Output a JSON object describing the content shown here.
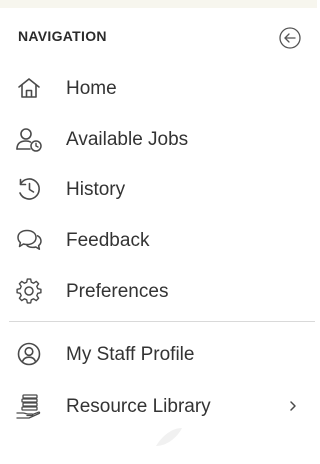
{
  "header": {
    "title": "NAVIGATION",
    "collapse_icon": "arrow-left-circle-icon"
  },
  "primary_items": [
    {
      "label": "Home",
      "icon": "home-icon"
    },
    {
      "label": "Available Jobs",
      "icon": "user-clock-icon"
    },
    {
      "label": "History",
      "icon": "history-icon"
    },
    {
      "label": "Feedback",
      "icon": "chat-bubbles-icon"
    },
    {
      "label": "Preferences",
      "icon": "gear-icon"
    }
  ],
  "secondary_items": [
    {
      "label": "My Staff Profile",
      "icon": "user-circle-icon"
    },
    {
      "label": "Resource Library",
      "icon": "books-hand-icon",
      "has_submenu": true
    }
  ],
  "colors": {
    "text": "#333333",
    "icon": "#4a4a4a",
    "divider": "#d9d9d9",
    "top_strip": "#f7f6ee"
  }
}
